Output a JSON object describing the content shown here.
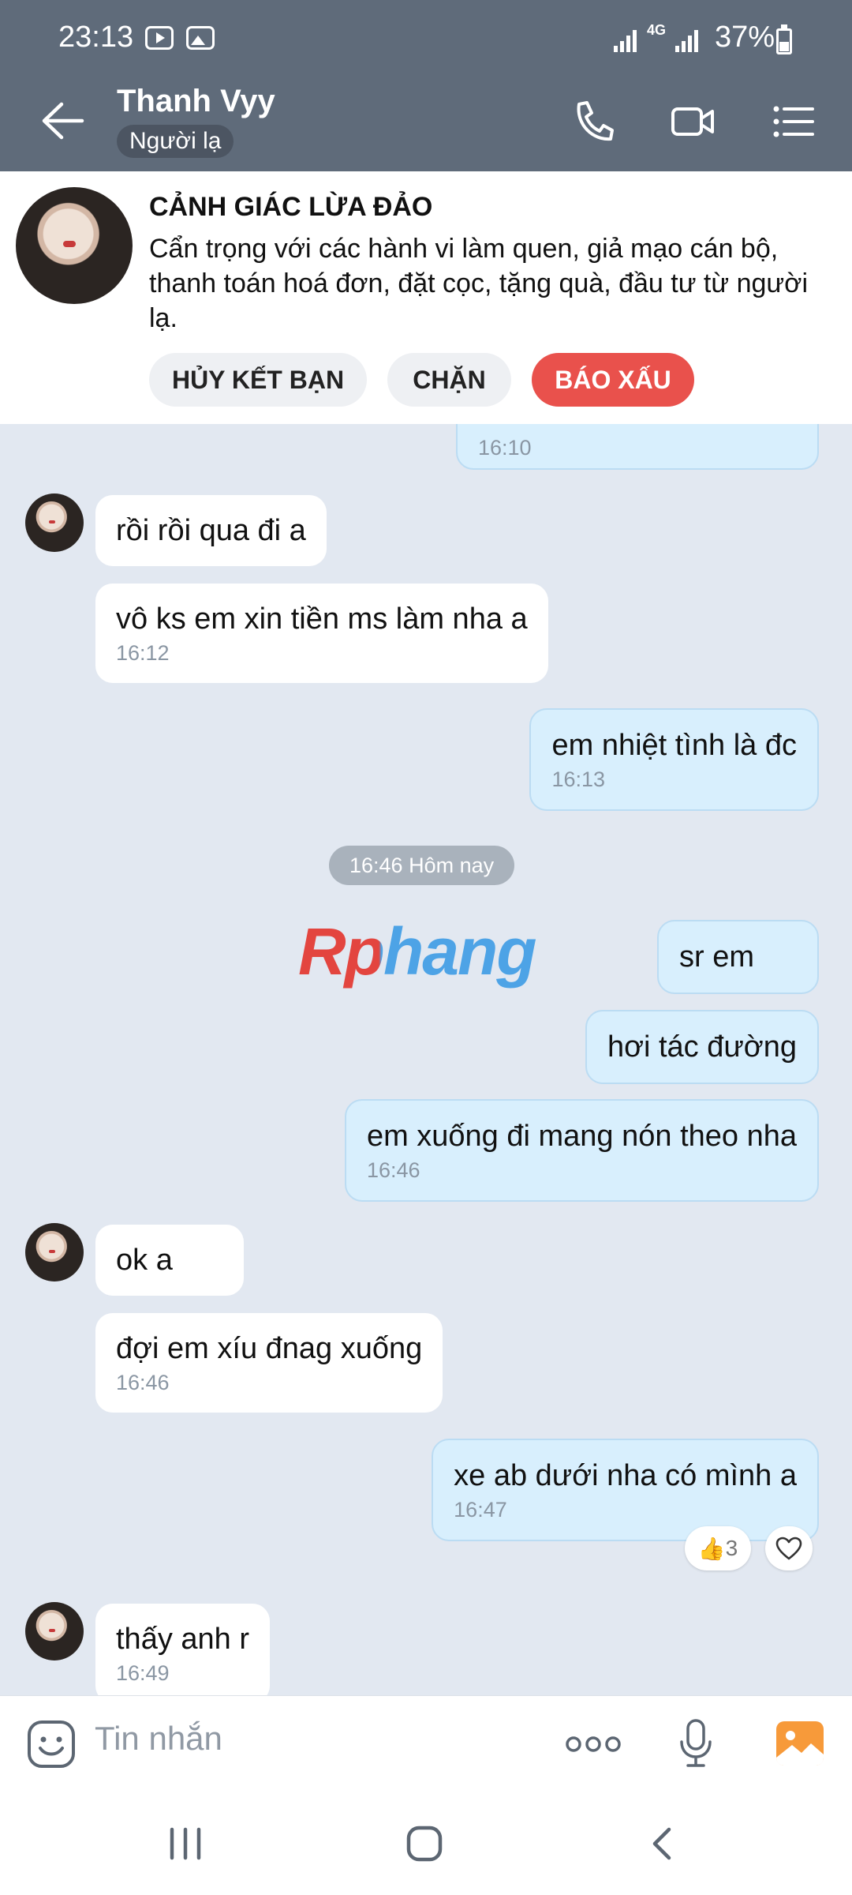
{
  "status_bar": {
    "time": "23:13",
    "network": "4G",
    "battery": "37%"
  },
  "header": {
    "name": "Thanh Vyy",
    "tag": "Người lạ"
  },
  "warning": {
    "title": "CẢNH GIÁC LỪA ĐẢO",
    "text": "Cẩn trọng với các hành vi làm quen, giả mạo cán bộ, thanh toán hoá đơn, đặt cọc, tặng quà, đầu tư từ người lạ.",
    "buttons": {
      "unfriend": "HỦY KẾT BẠN",
      "block": "CHẶN",
      "report": "BÁO XẤU"
    }
  },
  "messages": [
    {
      "dir": "out",
      "text": "",
      "time": "16:10"
    },
    {
      "dir": "in",
      "text": "rồi rồi qua đi a",
      "time": ""
    },
    {
      "dir": "in",
      "text": "vô ks em xin tiền ms làm nha a",
      "time": "16:12"
    },
    {
      "dir": "out",
      "text": "em nhiệt tình là đc",
      "time": "16:13"
    },
    {
      "dir": "out",
      "text": "sr em",
      "time": ""
    },
    {
      "dir": "out",
      "text": "hơi tác đường",
      "time": ""
    },
    {
      "dir": "out",
      "text": "em xuống đi mang nón theo nha",
      "time": "16:46"
    },
    {
      "dir": "in",
      "text": "ok a",
      "time": ""
    },
    {
      "dir": "in",
      "text": "đợi em xíu đnag xuống",
      "time": "16:46"
    },
    {
      "dir": "out",
      "text": "xe ab dưới nha có mình a",
      "time": "16:47"
    },
    {
      "dir": "in",
      "text": "thấy anh r",
      "time": "16:49"
    }
  ],
  "time_separator": "16:46 Hôm nay",
  "watermark": "Rphang",
  "reaction": {
    "emoji": "👍",
    "count": "3"
  },
  "input": {
    "placeholder": "Tin nhắn"
  },
  "icons": {
    "back": "arrow-left",
    "call": "phone",
    "video": "video-camera",
    "menu": "list",
    "sticker": "smiley",
    "more": "dots",
    "mic": "microphone",
    "gallery": "image",
    "recent": "three-bars",
    "home": "rounded-square",
    "nav_back": "chevron-left"
  }
}
